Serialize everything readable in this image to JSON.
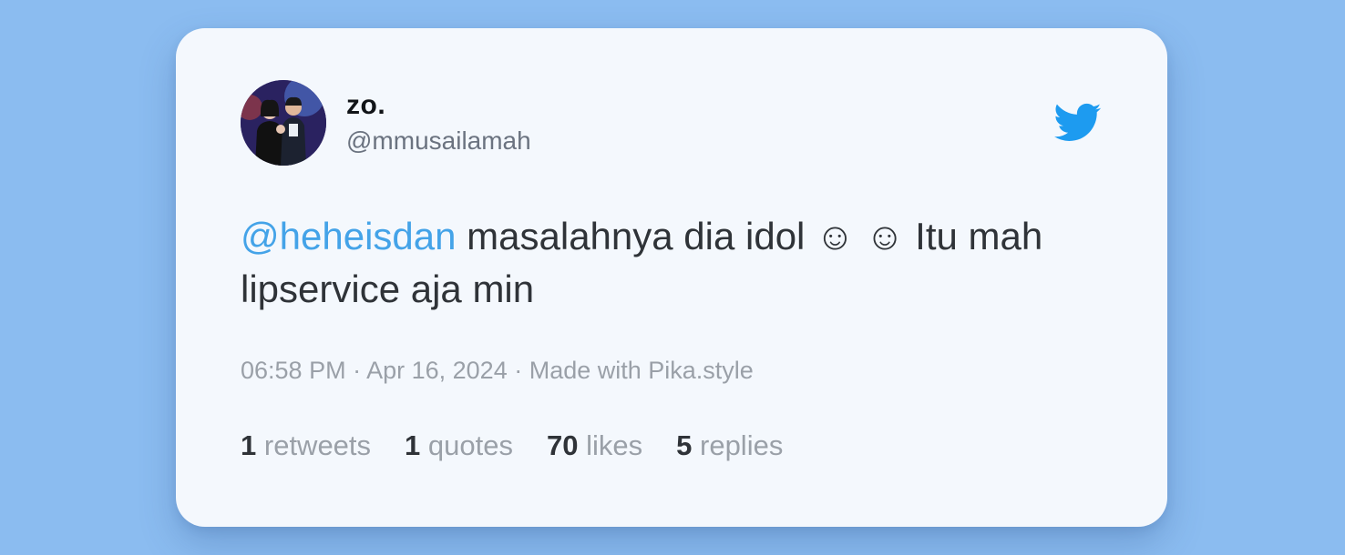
{
  "user": {
    "name": "zo.",
    "handle": "@mmusailamah"
  },
  "tweet": {
    "mention": "@heheisdan",
    "text": " masalahnya dia idol ☺︎ ☺︎ Itu mah lipservice aja min"
  },
  "meta": {
    "time": "06:58 PM",
    "date": "Apr 16, 2024",
    "credit": "Made with Pika.style",
    "separator": " · "
  },
  "stats": [
    {
      "count": "1",
      "label": "retweets"
    },
    {
      "count": "1",
      "label": "quotes"
    },
    {
      "count": "70",
      "label": "likes"
    },
    {
      "count": "5",
      "label": "replies"
    }
  ],
  "icons": {
    "brand": "twitter-bird-icon",
    "brand_color": "#1d9bf0"
  },
  "colors": {
    "background": "#8bbcf0",
    "card": "#f4f8fd",
    "mention": "#44a3e8"
  }
}
